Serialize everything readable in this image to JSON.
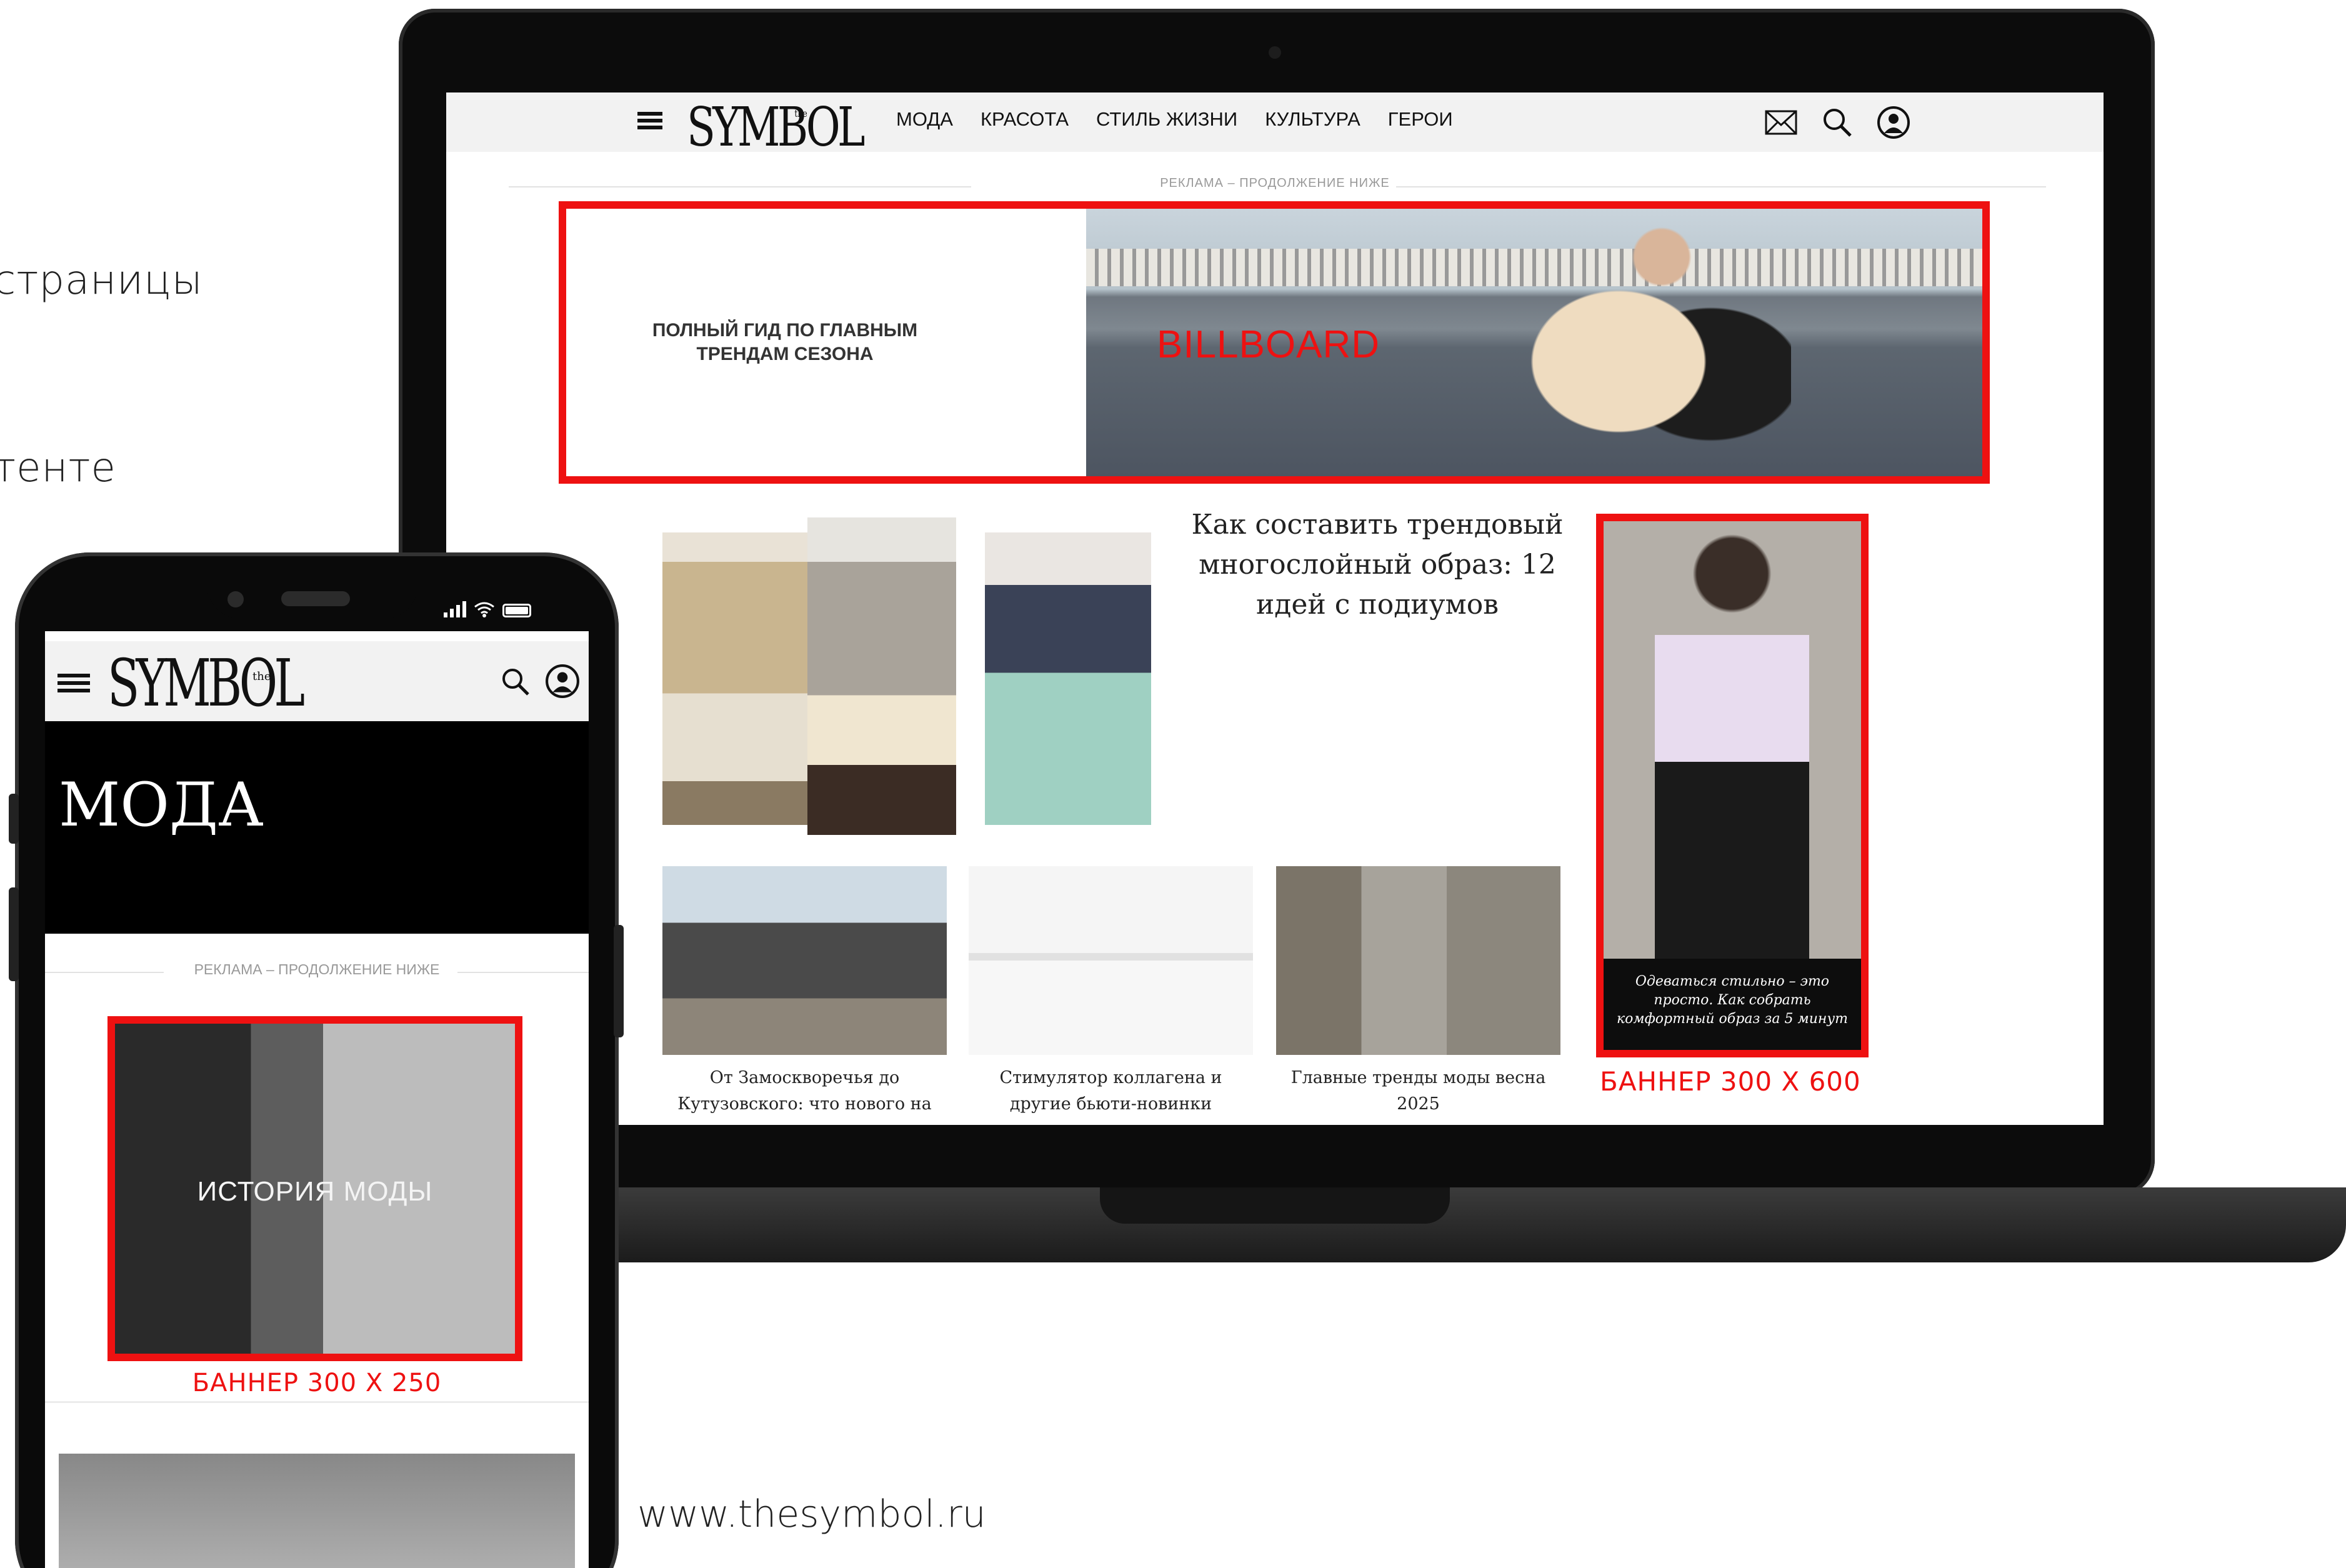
{
  "slide": {
    "side_text": [
      "страницы",
      "тенте"
    ],
    "url": "www.thesymbol.ru"
  },
  "desktop": {
    "logo": "SYMBOL",
    "logo_small": "the",
    "nav": [
      "МОДА",
      "КРАСОТА",
      "СТИЛЬ ЖИЗНИ",
      "КУЛЬТУРА",
      "ГЕРОИ"
    ],
    "icons": [
      "mail-icon",
      "search-icon",
      "user-icon"
    ],
    "ad_label": "РЕКЛАМА – ПРОДОЛЖЕНИЕ НИЖЕ",
    "billboard": {
      "text": "ПОЛНЫЙ ГИД ПО ГЛАВНЫМ ТРЕНДАМ СЕЗОНА",
      "label": "BILLBOARD"
    },
    "featured_title": "Как составить трендовый многослойный образ: 12 идей с подиумов",
    "cards": [
      {
        "caption": "От Замоскворечья до Кутузовского: что нового на"
      },
      {
        "caption": "Стимулятор коллагена и другие бьюти-новинки"
      },
      {
        "caption": "Главные тренды моды весна 2025"
      }
    ],
    "tall_banner": {
      "caption": "Одеваться стильно – это просто. Как собрать комфортный образ за 5 минут",
      "note": "БАННЕР 300 Х 600"
    },
    "colors": {
      "accent": "#ee1111",
      "header_bg": "#f2f2f2"
    }
  },
  "mobile": {
    "logo": "SYMBOL",
    "logo_small": "the",
    "section_title": "МОДА",
    "ad_label": "РЕКЛАМА – ПРОДОЛЖЕНИЕ НИЖЕ",
    "banner": {
      "label": "ИСТОРИЯ МОДЫ",
      "note": "БАННЕР 300 Х 250"
    },
    "icons": [
      "menu-icon",
      "search-icon",
      "user-icon"
    ]
  }
}
